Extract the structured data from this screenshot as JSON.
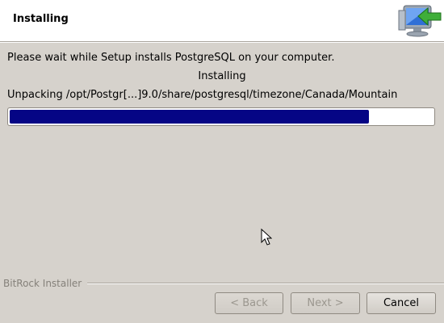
{
  "window": {
    "title": "Installing"
  },
  "header": {
    "icon": "installer-computer-icon"
  },
  "content": {
    "message": "Please wait while Setup installs PostgreSQL on your computer.",
    "status": "Installing",
    "detail": "Unpacking /opt/Postgr[...]9.0/share/postgresql/timezone/Canada/Mountain",
    "progress_fraction": 0.85
  },
  "footer": {
    "brand": "BitRock Installer",
    "back_label": "< Back",
    "next_label": "Next >",
    "cancel_label": "Cancel"
  },
  "colors": {
    "progress_fill": "#050585",
    "background": "#d6d2cc"
  }
}
